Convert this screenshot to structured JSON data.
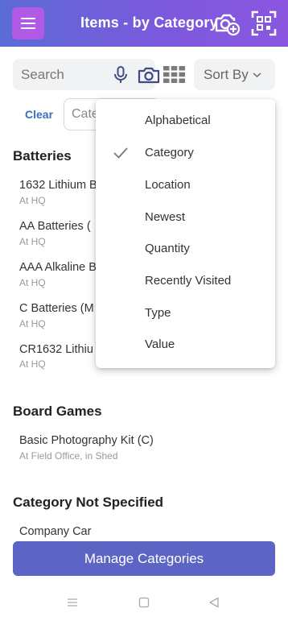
{
  "header": {
    "title": "Items - by Category",
    "icons": [
      "menu-icon",
      "add-photo-icon",
      "qr-scan-icon"
    ],
    "accent": "#6a63da"
  },
  "search": {
    "placeholder": "Search",
    "icons": [
      "microphone-icon",
      "camera-icon",
      "grid-view-icon"
    ]
  },
  "sort": {
    "label": "Sort By",
    "chevron": "⌄"
  },
  "filter": {
    "clear_label": "Clear",
    "category_placeholder": "Cate"
  },
  "sections": [
    {
      "title": "Batteries",
      "items": [
        {
          "name": "1632 Lithium B",
          "location": "At HQ"
        },
        {
          "name": "AA Batteries (",
          "location": "At HQ"
        },
        {
          "name": "AAA Alkaline B",
          "location": "At HQ"
        },
        {
          "name": "C Batteries (M",
          "location": "At HQ"
        },
        {
          "name": "CR1632 Lithiu",
          "location": "At HQ"
        }
      ]
    },
    {
      "title": "Board Games",
      "items": [
        {
          "name": "Basic Photography Kit (C)",
          "location": "At Field Office, in Shed"
        }
      ]
    },
    {
      "title": "Category Not Specified",
      "items": [
        {
          "name": "Company Car",
          "location": ""
        }
      ]
    }
  ],
  "sort_menu": {
    "options": [
      "Alphabetical",
      "Category",
      "Location",
      "Newest",
      "Quantity",
      "Recently Visited",
      "Type",
      "Value"
    ],
    "selected": "Category"
  },
  "footer": {
    "manage_label": "Manage Categories"
  },
  "system_nav": [
    "recents-icon",
    "home-icon",
    "back-icon"
  ]
}
